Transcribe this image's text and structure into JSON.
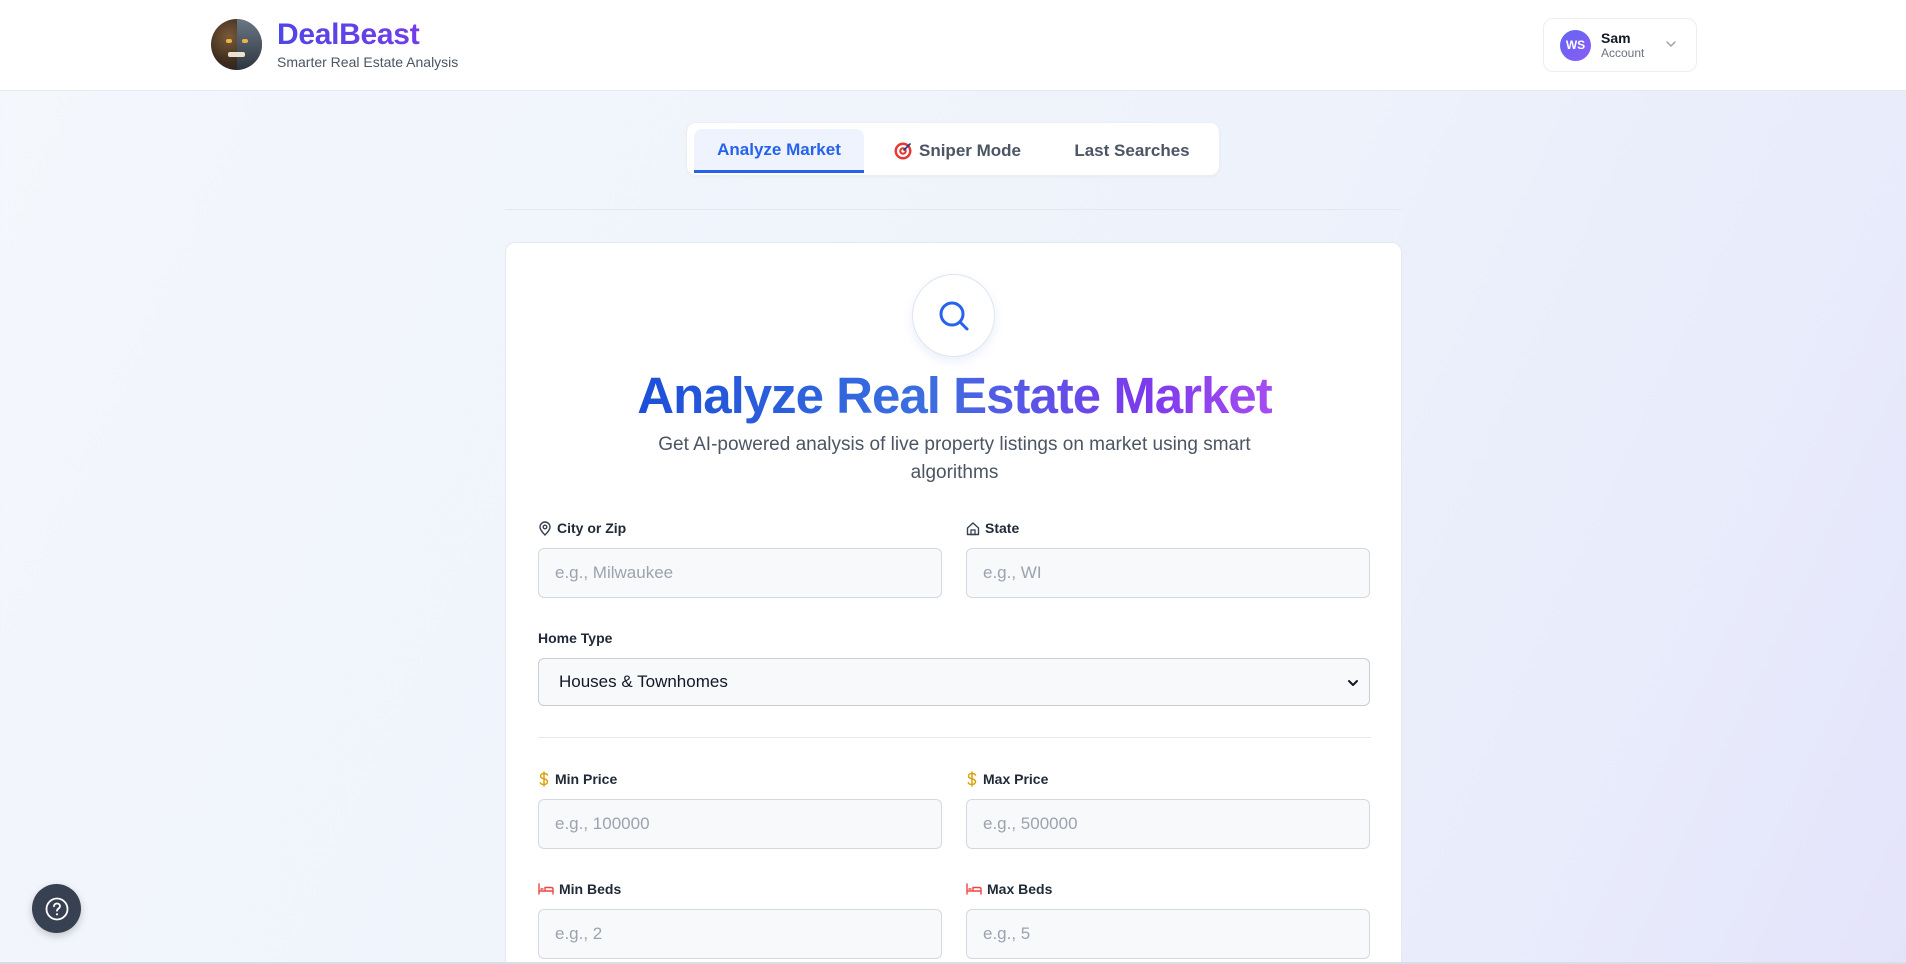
{
  "header": {
    "brand_name": "DealBeast",
    "brand_tagline": "Smarter Real Estate Analysis",
    "account": {
      "initials": "WS",
      "name": "Sam",
      "subtitle": "Account"
    }
  },
  "tabs": [
    {
      "label": "Analyze Market",
      "active": true
    },
    {
      "label": "Sniper Mode",
      "icon": "target-icon",
      "active": false
    },
    {
      "label": "Last Searches",
      "active": false
    }
  ],
  "main": {
    "title": "Analyze Real Estate Market",
    "subtitle": "Get AI-powered analysis of live property listings on market using smart algorithms",
    "fields": {
      "city": {
        "label": "City or Zip",
        "placeholder": "e.g., Milwaukee",
        "icon": "map-pin-icon"
      },
      "state": {
        "label": "State",
        "placeholder": "e.g., WI",
        "icon": "building-icon"
      },
      "home_type": {
        "label": "Home Type",
        "value": "Houses & Townhomes"
      },
      "min_price": {
        "label": "Min Price",
        "placeholder": "e.g., 100000",
        "icon": "dollar-icon"
      },
      "max_price": {
        "label": "Max Price",
        "placeholder": "e.g., 500000",
        "icon": "dollar-icon"
      },
      "min_beds": {
        "label": "Min Beds",
        "placeholder": "e.g., 2",
        "icon": "bed-icon"
      },
      "max_beds": {
        "label": "Max Beds",
        "placeholder": "e.g., 5",
        "icon": "bed-icon"
      }
    }
  },
  "colors": {
    "primary": "#2563eb",
    "accent": "#7c3aed",
    "price_icon": "#d9a30b",
    "bed_icon": "#ef4444"
  }
}
